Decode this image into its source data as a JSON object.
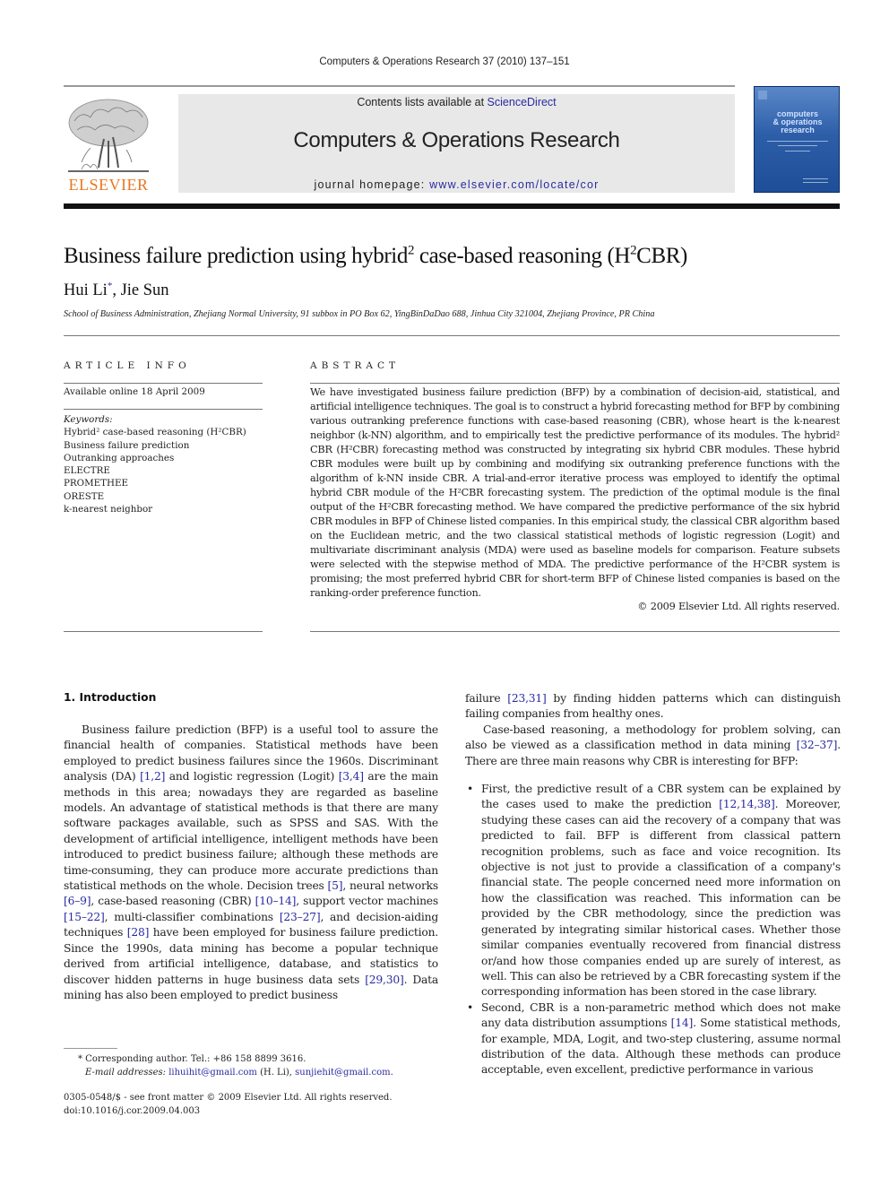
{
  "running_head": "Computers & Operations Research 37 (2010) 137–151",
  "journal_banner": {
    "contents_prefix": "Contents lists available at ",
    "contents_link": "ScienceDirect",
    "journal_title": "Computers & Operations Research",
    "homepage_prefix": "journal homepage: ",
    "homepage_link": "www.elsevier.com/locate/cor"
  },
  "publisher_logo": {
    "text": "ELSEVIER",
    "color": "#e87722"
  },
  "cover": {
    "title_lines": [
      "computers",
      "& operations",
      "research"
    ]
  },
  "article": {
    "title_parts": [
      "Business failure prediction using hybrid",
      "2",
      " case-based reasoning (H",
      "2",
      "CBR)"
    ],
    "authors": [
      {
        "name": "Hui Li",
        "mark": "*"
      },
      {
        "name": "Jie Sun",
        "mark": ""
      }
    ],
    "affiliation": "School of Business Administration, Zhejiang Normal University, 91 subbox in PO Box 62, YingBinDaDao 688, Jinhua City 321004, Zhejiang Province, PR China"
  },
  "article_info": {
    "heading": "ARTICLE INFO",
    "available_online": "Available online 18 April 2009",
    "keywords_label": "Keywords:",
    "keywords": [
      "Hybrid² case-based reasoning (H²CBR)",
      "Business failure prediction",
      "Outranking approaches",
      "ELECTRE",
      "PROMETHEE",
      "ORESTE",
      "k-nearest neighbor"
    ]
  },
  "abstract": {
    "heading": "ABSTRACT",
    "text": "We have investigated business failure prediction (BFP) by a combination of decision-aid, statistical, and artificial intelligence techniques. The goal is to construct a hybrid forecasting method for BFP by combining various outranking preference functions with case-based reasoning (CBR), whose heart is the k-nearest neighbor (k-NN) algorithm, and to empirically test the predictive performance of its modules. The hybrid² CBR (H²CBR) forecasting method was constructed by integrating six hybrid CBR modules. These hybrid CBR modules were built up by combining and modifying six outranking preference functions with the algorithm of k-NN inside CBR. A trial-and-error iterative process was employed to identify the optimal hybrid CBR module of the H²CBR forecasting system. The prediction of the optimal module is the final output of the H²CBR forecasting method. We have compared the predictive performance of the six hybrid CBR modules in BFP of Chinese listed companies. In this empirical study, the classical CBR algorithm based on the Euclidean metric, and the two classical statistical methods of logistic regression (Logit) and multivariate discriminant analysis (MDA) were used as baseline models for comparison. Feature subsets were selected with the stepwise method of MDA. The predictive performance of the H²CBR system is promising; the most preferred hybrid CBR for short-term BFP of Chinese listed companies is based on the ranking-order preference function.",
    "copyright": "© 2009 Elsevier Ltd. All rights reserved."
  },
  "introduction": {
    "heading": "1.  Introduction",
    "left_paragraph": [
      "Business failure prediction (BFP) is a useful tool to assure the financial health of companies. Statistical methods have been employed to predict business failures since the 1960s. Discriminant analysis (DA) ",
      {
        "ref": "[1,2]"
      },
      " and logistic regression (Logit) ",
      {
        "ref": "[3,4]"
      },
      " are the main methods in this area; nowadays they are regarded as baseline models. An advantage of statistical methods is that there are many software packages available, such as SPSS and SAS. With the development of artificial intelligence, intelligent methods have been introduced to predict business failure; although these methods are time-consuming, they can produce more accurate predictions than statistical methods on the whole. Decision trees ",
      {
        "ref": "[5]"
      },
      ", neural networks ",
      {
        "ref": "[6–9]"
      },
      ", case-based reasoning (CBR) ",
      {
        "ref": "[10–14]"
      },
      ", support vector machines ",
      {
        "ref": "[15–22]"
      },
      ", multi-classifier combinations ",
      {
        "ref": "[23–27]"
      },
      ", and decision-aiding techniques ",
      {
        "ref": "[28]"
      },
      " have been employed for business failure prediction. Since the 1990s, data mining has become a popular technique derived from artificial intelligence, database, and statistics to discover hidden patterns in huge business data sets ",
      {
        "ref": "[29,30]"
      },
      ". Data mining has also been employed to predict business"
    ],
    "right_continuation": [
      "failure ",
      {
        "ref": "[23,31]"
      },
      " by finding hidden patterns which can distinguish failing companies from healthy ones."
    ],
    "right_paragraph": [
      "Case-based reasoning, a methodology for problem solving, can also be viewed as a classification method in data mining ",
      {
        "ref": "[32–37]"
      },
      ". There are three main reasons why CBR is interesting for BFP:"
    ],
    "bullets": [
      [
        "First, the predictive result of a CBR system can be explained by the cases used to make the prediction ",
        {
          "ref": "[12,14,38]"
        },
        ". Moreover, studying these cases can aid the recovery of a company that was predicted to fail. BFP is different from classical pattern recognition problems, such as face and voice recognition. Its objective is not just to provide a classification of a company's financial state. The people concerned need more information on how the classification was reached. This information can be provided by the CBR methodology, since the prediction was generated by integrating similar historical cases. Whether those similar companies eventually recovered from financial distress or/and how those companies ended up are surely of interest, as well. This can also be retrieved by a CBR forecasting system if the corresponding information has been stored in the case library."
      ],
      [
        "Second, CBR is a non-parametric method which does not make any data distribution assumptions ",
        {
          "ref": "[14]"
        },
        ". Some statistical methods, for example, MDA, Logit, and two-step clustering, assume normal distribution of the data. Although these methods can produce acceptable, even excellent, predictive performance in various"
      ]
    ]
  },
  "footnote": {
    "corresponding": "* Corresponding author. Tel.: +86 158 8899 3616.",
    "email_label": "E-mail addresses: ",
    "email_1": "lihuihit@gmail.com",
    "email_1_owner": " (H. Li), ",
    "email_2": "sunjiehit@gmail.com",
    "email_end": "."
  },
  "front_matter": {
    "issn_line": "0305-0548/$ - see front matter © 2009 Elsevier Ltd. All rights reserved.",
    "doi": "doi:10.1016/j.cor.2009.04.003"
  },
  "colors": {
    "link": "#2a2aa0",
    "elsevier_orange": "#e87722",
    "banner_bg": "#e8e8e8"
  }
}
